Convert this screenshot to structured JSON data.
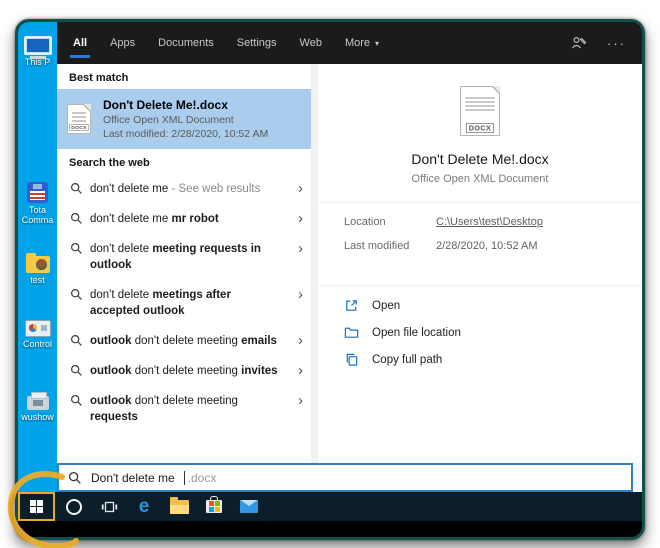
{
  "header": {
    "tabs": [
      "All",
      "Apps",
      "Documents",
      "Settings",
      "Web",
      "More"
    ],
    "caret": "▾",
    "ellipsis": "···"
  },
  "left_pane": {
    "best_match": {
      "section_label": "Best match",
      "title": "Don't Delete Me!.docx",
      "subtitle": "Office Open XML Document",
      "last_modified": "Last modified: 2/28/2020, 10:52 AM",
      "badge": "DOCX"
    },
    "web_section": {
      "section_label": "Search the web",
      "chevron": "›",
      "suggestions": [
        {
          "segments": [
            {
              "t": "don't delete me"
            },
            {
              "t": " - See web results"
            }
          ]
        },
        {
          "segments": [
            {
              "t": "don't delete me "
            },
            {
              "t": "mr robot"
            }
          ]
        },
        {
          "segments": [
            {
              "t": "don't delete "
            },
            {
              "t": "meeting requests in\noutlook"
            }
          ]
        },
        {
          "segments": [
            {
              "t": "don't delete "
            },
            {
              "t": "meetings after\naccepted outlook"
            }
          ]
        },
        {
          "segments": [
            {
              "t": "outlook "
            },
            {
              "t": "don't delete meeting "
            },
            {
              "t": "emails"
            }
          ]
        },
        {
          "segments": [
            {
              "t": "outlook "
            },
            {
              "t": "don't delete meeting "
            },
            {
              "t": "invites"
            }
          ]
        },
        {
          "segments": [
            {
              "t": "outlook "
            },
            {
              "t": "don't delete meeting\n"
            },
            {
              "t": "requests"
            }
          ]
        }
      ]
    }
  },
  "preview": {
    "badge": "DOCX",
    "title": "Don't Delete Me!.docx",
    "subtitle": "Office Open XML Document",
    "details": [
      {
        "label": "Location",
        "value": "C:\\Users\\test\\Desktop"
      },
      {
        "label": "Last modified",
        "value": "2/28/2020, 10:52 AM"
      }
    ],
    "actions": [
      {
        "label": "Open"
      },
      {
        "label": "Open file location"
      },
      {
        "label": "Copy full path"
      }
    ]
  },
  "search_box": {
    "query": "Don't delete me",
    "completion": ".docx"
  },
  "taskbar": {
    "edge_letter": "e"
  },
  "desktop_icons": [
    "This P",
    "Tota Comma",
    "test",
    "Control",
    "wushow"
  ],
  "colors": {
    "frame_green": "#115149",
    "accent_blue": "#2a7cd4",
    "best_match_highlight": "#aacdee",
    "search_border_blue": "#2f7fc4",
    "desktop_blue": "#00a3e8",
    "taskbar_dark": "#0d1e2b",
    "action_icon_blue": "#1573c4",
    "annotation_gold": "#e7a82e"
  }
}
